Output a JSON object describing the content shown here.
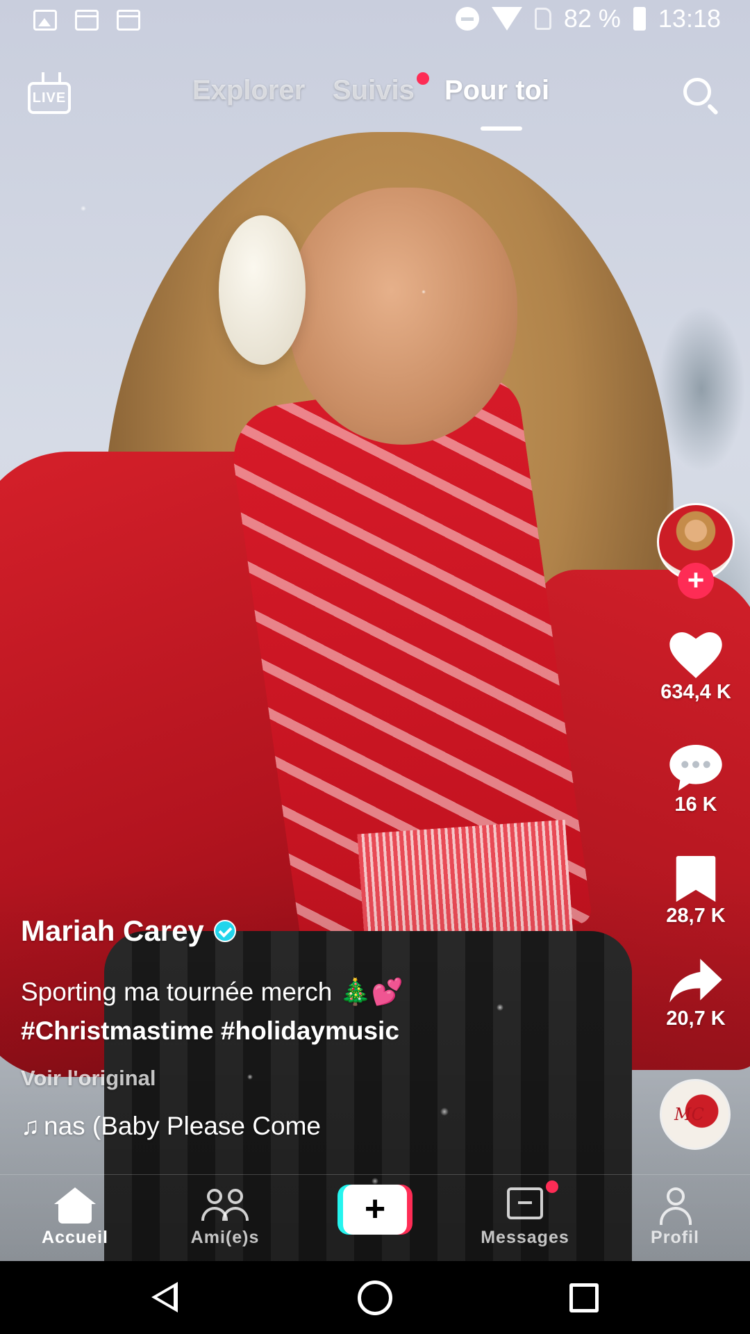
{
  "status_bar": {
    "battery": "82 %",
    "time": "13:18",
    "icons": [
      "image-icon",
      "calendar-icon",
      "calendar-icon",
      "do-not-disturb-icon",
      "wifi-icon",
      "no-sim-icon",
      "battery-icon"
    ]
  },
  "top_nav": {
    "live_label": "LIVE",
    "tabs": [
      {
        "label": "Explorer",
        "active": false
      },
      {
        "label": "Suivis",
        "active": false,
        "has_dot": true
      },
      {
        "label": "Pour toi",
        "active": true
      }
    ]
  },
  "post": {
    "username": "Mariah Carey",
    "verified": true,
    "description": "Sporting ma tournée merch 🎄💕",
    "hashtags": "#Christmastime #holidaymusic",
    "see_original": "Voir l'original",
    "sound": "nas (Baby Please Come"
  },
  "actions": {
    "likes": "634,4 K",
    "comments": "16 K",
    "saves": "28,7 K",
    "shares": "20,7 K"
  },
  "bottom_nav": {
    "items": [
      {
        "label": "Accueil",
        "icon": "home-icon",
        "active": true
      },
      {
        "label": "Ami(e)s",
        "icon": "friends-icon",
        "active": false
      },
      {
        "label": "",
        "icon": "create-plus-icon",
        "active": false
      },
      {
        "label": "Messages",
        "icon": "messages-icon",
        "active": false,
        "has_dot": true
      },
      {
        "label": "Profil",
        "icon": "profile-icon",
        "active": false
      }
    ]
  },
  "colors": {
    "accent": "#fe2c55",
    "cyan": "#25f4ee",
    "verified": "#20d5ec"
  }
}
